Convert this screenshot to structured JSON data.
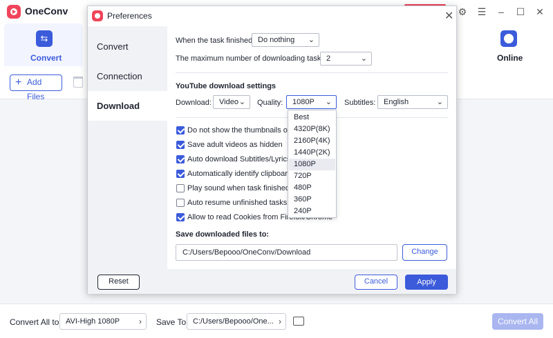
{
  "app": {
    "name": "OneConv"
  },
  "nav": {
    "convert_label": "Convert",
    "online_label": "Online"
  },
  "toolbar": {
    "add_files_label": "Add Files"
  },
  "bottom": {
    "convert_all_to_label": "Convert All to:",
    "format_value": "AVI-High 1080P",
    "save_to_label": "Save To:",
    "save_to_value": "C:/Users/Bepooo/One...",
    "convert_all_button": "Convert All"
  },
  "dialog": {
    "title": "Preferences",
    "sidebar": [
      {
        "label": "Convert"
      },
      {
        "label": "Connection"
      },
      {
        "label": "Download"
      }
    ],
    "task_finished_label": "When the task finished",
    "task_finished_value": "Do nothing",
    "max_tasks_label": "The maximum number of downloading tasks:",
    "max_tasks_value": "2",
    "youtube_section_title": "YouTube download settings",
    "download_label": "Download:",
    "download_value": "Video",
    "quality_label": "Quality:",
    "quality_value": "1080P",
    "subtitles_label": "Subtitles:",
    "subtitles_value": "English",
    "quality_options": [
      "Best",
      "4320P(8K)",
      "2160P(4K)",
      "1440P(2K)",
      "1080P",
      "720P",
      "480P",
      "360P",
      "240P"
    ],
    "checkboxes": [
      {
        "label": "Do not show the thumbnails of",
        "checked": true
      },
      {
        "label": "Save adult videos as hidden",
        "checked": true
      },
      {
        "label": "Auto download Subtitles/Lyrics",
        "checked": true
      },
      {
        "label": "Automatically identify clipboard",
        "checked": true
      },
      {
        "label": "Play sound when task finished",
        "checked": false
      },
      {
        "label": "Auto resume unfinished tasks o",
        "checked": false
      },
      {
        "label": "Allow to read Cookies from Firefox/Chrome",
        "checked": true
      }
    ],
    "save_path_title": "Save downloaded files to:",
    "save_path_value": "C:/Users/Bepooo/OneConv/Download",
    "change_button": "Change",
    "reset_button": "Reset",
    "cancel_button": "Cancel",
    "apply_button": "Apply"
  },
  "colors": {
    "accent": "#3b5bdb",
    "brand": "#f0445a",
    "disabled_button": "#a9b6f0"
  }
}
